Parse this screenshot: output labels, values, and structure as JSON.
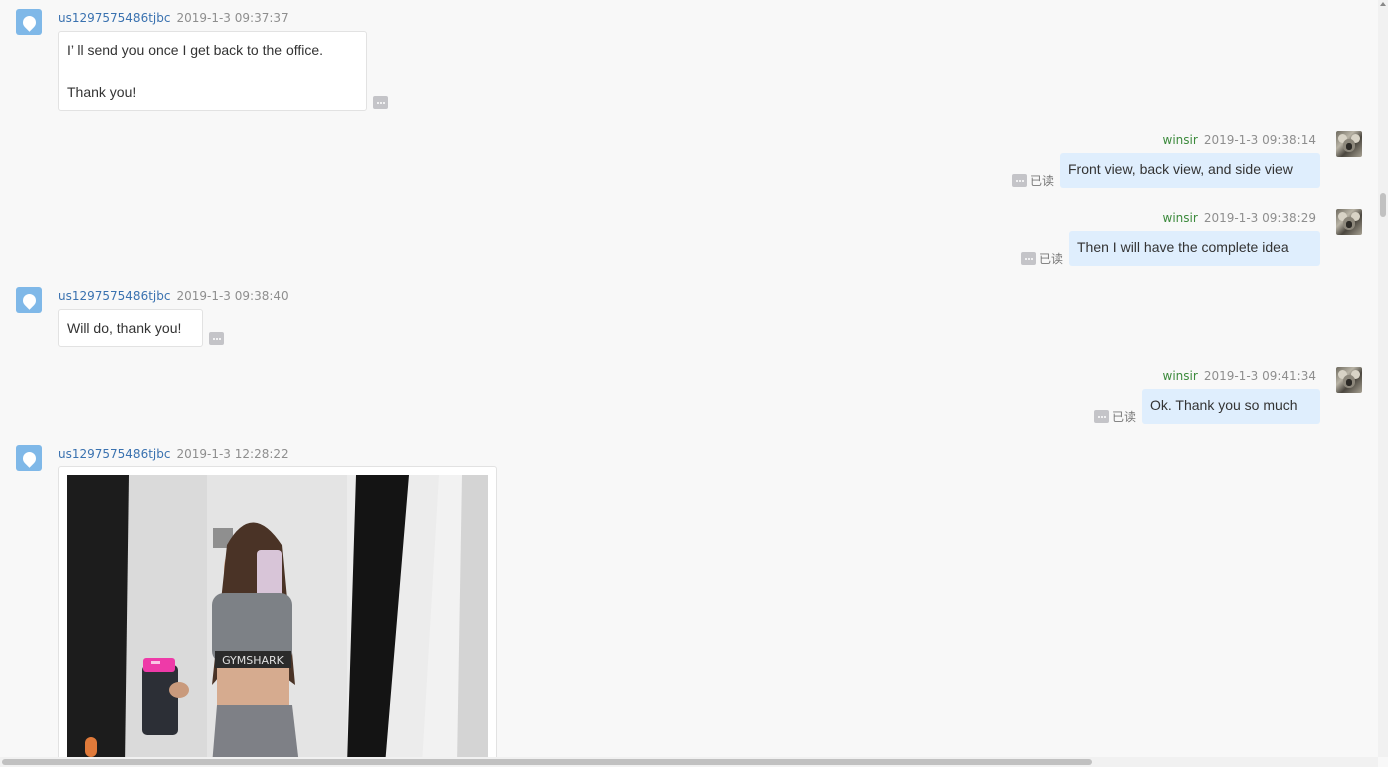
{
  "messages": [
    {
      "sender": "us1297575486tjbc",
      "time": "2019-1-3 09:37:37",
      "lines": [
        "I’ ll send you once I get back to the office.",
        "Thank you!"
      ]
    },
    {
      "sender": "winsir",
      "time": "2019-1-3 09:38:14",
      "text": "Front view, back view, and side view",
      "status": "已读"
    },
    {
      "sender": "winsir",
      "time": "2019-1-3 09:38:29",
      "text": "Then I will have the complete idea",
      "status": "已读"
    },
    {
      "sender": "us1297575486tjbc",
      "time": "2019-1-3 09:38:40",
      "text": "Will do, thank you!"
    },
    {
      "sender": "winsir",
      "time": "2019-1-3 09:41:34",
      "text": "Ok. Thank you so much",
      "status": "已读"
    },
    {
      "sender": "us1297575486tjbc",
      "time": "2019-1-3 12:28:22",
      "image_text": "GYMSHARK"
    }
  ],
  "colors": {
    "user_name": "#3a72b0",
    "me_name": "#3c8a3c",
    "bubble_out": "#dfeefd",
    "bubble_in": "#ffffff"
  }
}
